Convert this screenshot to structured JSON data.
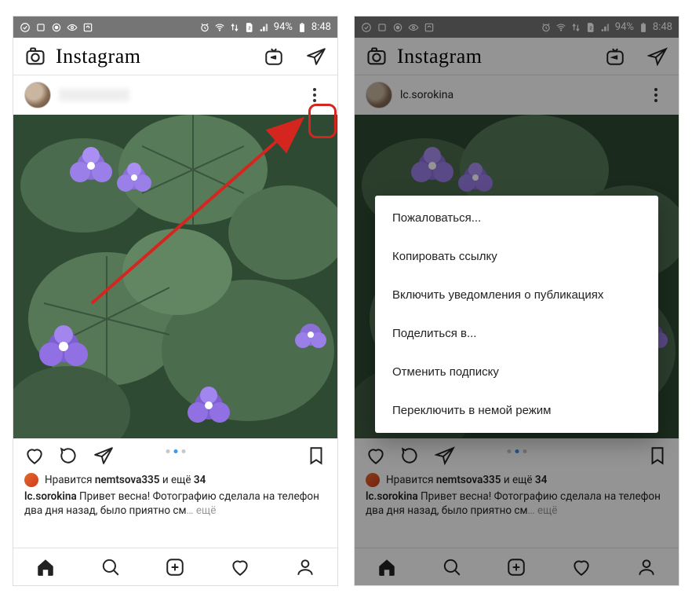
{
  "status": {
    "battery": "94%",
    "time": "8:48"
  },
  "header": {
    "logo": "Instagram"
  },
  "post": {
    "username_left_hidden": "",
    "username": "lc.sorokina",
    "likes_prefix": "Нравится ",
    "likes_user": "nemtsova335",
    "likes_suffix": " и ещё ",
    "likes_count": "34",
    "caption_user": "lc.sorokina",
    "caption_text": " Привет весна! Фотографию сделала на телефон два дня назад, было приятно см",
    "more": "… ещё"
  },
  "menu": {
    "items": [
      "Пожаловаться...",
      "Копировать ссылку",
      "Включить уведомления о публикациях",
      "Поделиться в...",
      "Отменить подписку",
      "Переключить в немой режим"
    ]
  }
}
